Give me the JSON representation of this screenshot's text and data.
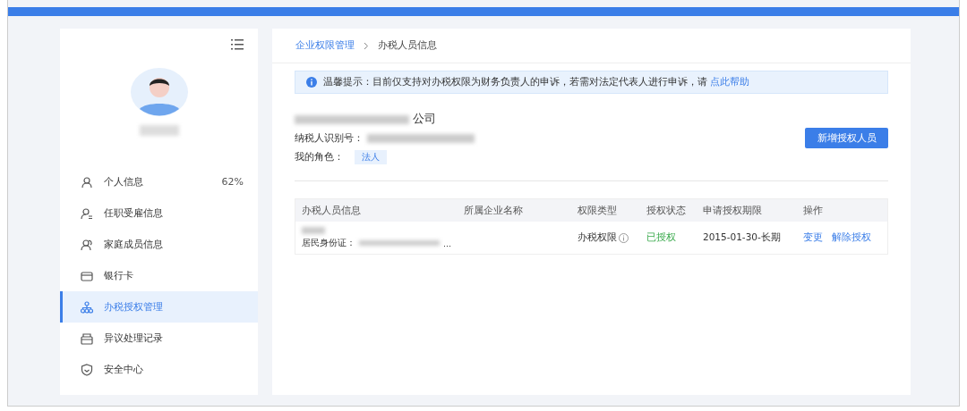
{
  "sidebar": {
    "items": [
      {
        "label": "个人信息",
        "badge": "62%",
        "selected": false
      },
      {
        "label": "任职受雇信息",
        "selected": false
      },
      {
        "label": "家庭成员信息",
        "selected": false
      },
      {
        "label": "银行卡",
        "selected": false
      },
      {
        "label": "办税授权管理",
        "selected": true
      },
      {
        "label": "异议处理记录",
        "selected": false
      },
      {
        "label": "安全中心",
        "selected": false
      }
    ]
  },
  "breadcrumb": [
    "企业权限管理",
    "办税人员信息"
  ],
  "notice": {
    "text": "温馨提示：目前仅支持对办税权限为财务负责人的申诉，若需对法定代表人进行申诉，请",
    "link": "点此帮助"
  },
  "company": {
    "name_suffix": "公司",
    "taxpayer_id_label": "纳税人识别号：",
    "role_label": "我的角色：",
    "role": "法人"
  },
  "add_button": "新增授权人员",
  "table": {
    "columns": [
      "办税人员信息",
      "所属企业名称",
      "权限类型",
      "授权状态",
      "申请授权期限",
      "操作"
    ],
    "rows": [
      {
        "id_label": "居民身份证：",
        "id_suffix": "...",
        "permission_type": "办税权限",
        "status": "已授权",
        "period": "2015-01-30-长期",
        "actions": [
          "变更",
          "解除授权"
        ]
      }
    ]
  }
}
